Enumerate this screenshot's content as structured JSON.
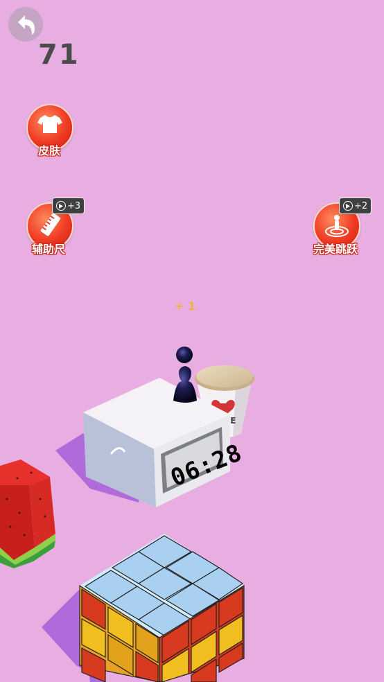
{
  "hud": {
    "score": "71",
    "back_icon": "undo-arrow-icon"
  },
  "powerups": {
    "skin": {
      "label": "皮肤",
      "icon": "tshirt-icon"
    },
    "ruler": {
      "label": "辅助尺",
      "icon": "ruler-icon",
      "badge": "+3",
      "badge_icon": "play-ad-icon"
    },
    "perfect_jump": {
      "label": "完美跳跃",
      "icon": "target-icon",
      "badge": "+2",
      "badge_icon": "play-ad-icon"
    }
  },
  "floating_bonus": "+ 1",
  "scene": {
    "clock_time": "06:28",
    "cup_text": "VE"
  },
  "colors": {
    "background": "#e9aee1",
    "button_red": "#ef3b24",
    "bonus_orange": "#f2b23c",
    "player": "#1b1a40"
  }
}
